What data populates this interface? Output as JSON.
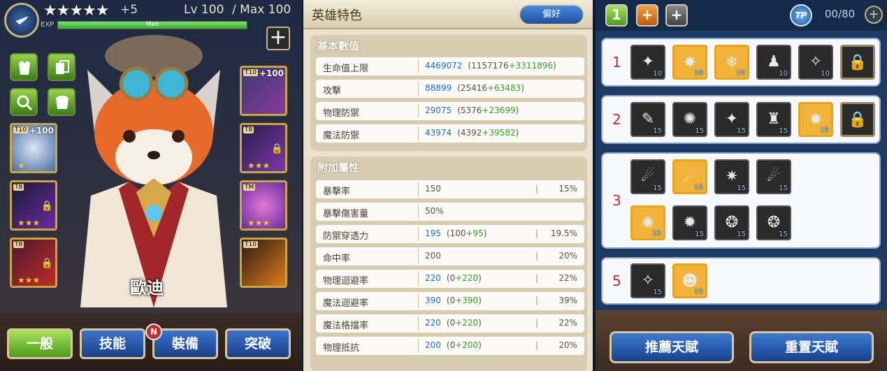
{
  "hero": {
    "stars": "★★★★★",
    "stars_bonus": "+5",
    "level": "Lv 100",
    "max_level": "/ Max 100",
    "exp_label": "EXP",
    "exp_text": "Max",
    "exp_fill": 1.0,
    "name": "歐迪"
  },
  "equipment": [
    {
      "tier": "T10",
      "enhance": "+100",
      "stars": ""
    },
    {
      "tier": "T10",
      "enhance": "+100",
      "stars": "★"
    },
    {
      "tier": "T8",
      "enhance": "",
      "stars": "★★★"
    },
    {
      "tier": "T8",
      "enhance": "",
      "stars": "★★★"
    },
    {
      "tier": "TM",
      "enhance": "",
      "stars": "★★★"
    },
    {
      "tier": "T8",
      "enhance": "",
      "stars": "★★★"
    },
    {
      "tier": "T10",
      "enhance": "",
      "stars": ""
    }
  ],
  "tabs": {
    "general": "一般",
    "skills": "技能",
    "equipment": "裝備",
    "breakthrough": "突破",
    "new_badge": "N"
  },
  "stats_panel": {
    "title": "英雄特色",
    "preference_button": "偏好",
    "basic_title": "基本數值",
    "basic": [
      {
        "label": "生命值上限",
        "value": "4469072",
        "base": "(1157176",
        "bonus": "+3311896",
        "close": ")"
      },
      {
        "label": "攻擊",
        "value": "88899",
        "base": "(25416",
        "bonus": "+63483",
        "close": ")"
      },
      {
        "label": "物理防禦",
        "value": "29075",
        "base": "(5376",
        "bonus": "+23699",
        "close": ")"
      },
      {
        "label": "魔法防禦",
        "value": "43974",
        "base": "(4392",
        "bonus": "+39582",
        "close": ")"
      }
    ],
    "extra_title": "附加屬性",
    "extra": [
      {
        "label": "暴擊率",
        "value": "150",
        "base": "",
        "bonus": "",
        "close": "",
        "pipe": "|",
        "pct": "15%"
      },
      {
        "label": "暴擊傷害量",
        "value": "50%",
        "base": "",
        "bonus": "",
        "close": "",
        "pipe": "",
        "pct": ""
      },
      {
        "label": "防禦穿透力",
        "value": "195",
        "base": "(100",
        "bonus": "+95",
        "close": ")",
        "pipe": "|",
        "pct": "19.5%"
      },
      {
        "label": "命中率",
        "value": "200",
        "base": "",
        "bonus": "",
        "close": "",
        "pipe": "|",
        "pct": "20%"
      },
      {
        "label": "物理迴避率",
        "value": "220",
        "base": "(0",
        "bonus": "+220",
        "close": ")",
        "pipe": "|",
        "pct": "22%"
      },
      {
        "label": "魔法迴避率",
        "value": "390",
        "base": "(0",
        "bonus": "+390",
        "close": ")",
        "pipe": "|",
        "pct": "39%"
      },
      {
        "label": "魔法格擋率",
        "value": "220",
        "base": "(0",
        "bonus": "+220",
        "close": ")",
        "pipe": "|",
        "pct": "22%"
      },
      {
        "label": "物理抵抗",
        "value": "200",
        "base": "(0",
        "bonus": "+200",
        "close": ")",
        "pipe": "|",
        "pct": "20%"
      }
    ]
  },
  "talents": {
    "top_buttons": {
      "one": "1",
      "plus_orange": "+",
      "plus_gray": "+"
    },
    "tp_label": "TP",
    "tp_count": "00/80",
    "tp_plus": "+",
    "rows": [
      {
        "num": "1",
        "skills": [
          {
            "level": "10",
            "selected": false,
            "locked": false,
            "glyph": "✦"
          },
          {
            "level": "10",
            "selected": true,
            "locked": false,
            "glyph": "✸"
          },
          {
            "level": "10",
            "selected": true,
            "locked": false,
            "glyph": "❄"
          },
          {
            "level": "10",
            "selected": false,
            "locked": false,
            "glyph": "♟"
          },
          {
            "level": "10",
            "selected": false,
            "locked": false,
            "glyph": "✧"
          },
          {
            "level": "",
            "selected": false,
            "locked": true,
            "glyph": "🔒"
          }
        ]
      },
      {
        "num": "2",
        "skills": [
          {
            "level": "15",
            "selected": false,
            "locked": false,
            "glyph": "✎"
          },
          {
            "level": "15",
            "selected": false,
            "locked": false,
            "glyph": "✺"
          },
          {
            "level": "15",
            "selected": false,
            "locked": false,
            "glyph": "✦"
          },
          {
            "level": "15",
            "selected": false,
            "locked": false,
            "glyph": "♜"
          },
          {
            "level": "15",
            "selected": true,
            "locked": false,
            "glyph": "✹"
          },
          {
            "level": "",
            "selected": false,
            "locked": true,
            "glyph": "🔒"
          }
        ]
      },
      {
        "num": "3",
        "skills": [
          {
            "level": "15",
            "selected": false,
            "locked": false,
            "glyph": "☄"
          },
          {
            "level": "15",
            "selected": true,
            "locked": false,
            "glyph": "☄"
          },
          {
            "level": "15",
            "selected": false,
            "locked": false,
            "glyph": "✷"
          },
          {
            "level": "15",
            "selected": false,
            "locked": false,
            "glyph": "☄"
          },
          {
            "level": "15",
            "selected": true,
            "locked": false,
            "glyph": "✺"
          },
          {
            "level": "15",
            "selected": false,
            "locked": false,
            "glyph": "✹"
          },
          {
            "level": "15",
            "selected": false,
            "locked": false,
            "glyph": "❂"
          },
          {
            "level": "15",
            "selected": false,
            "locked": false,
            "glyph": "❂"
          }
        ]
      },
      {
        "num": "5",
        "skills": [
          {
            "level": "15",
            "selected": false,
            "locked": false,
            "glyph": "✧"
          },
          {
            "level": "15",
            "selected": true,
            "locked": false,
            "glyph": "☻"
          }
        ]
      }
    ],
    "recommend_button": "推薦天賦",
    "reset_button": "重置天賦"
  },
  "colors": {
    "accent_blue": "#1d6fbf",
    "bonus_green": "#36a02a",
    "row_number_red": "#c0292b",
    "selected_gold": "#e7a31c"
  }
}
